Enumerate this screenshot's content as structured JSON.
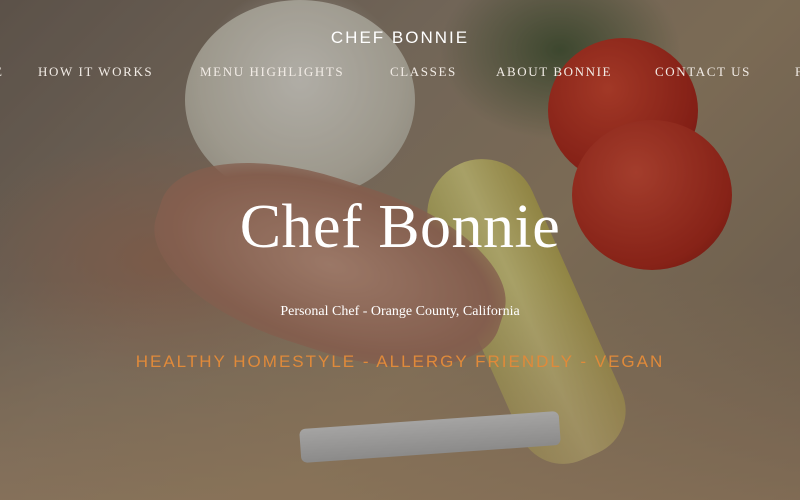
{
  "header": {
    "brand": "CHEF BONNIE"
  },
  "nav": {
    "items": [
      {
        "label": "E"
      },
      {
        "label": "HOW IT WORKS"
      },
      {
        "label": "MENU HIGHLIGHTS"
      },
      {
        "label": "CLASSES"
      },
      {
        "label": "ABOUT BONNIE"
      },
      {
        "label": "CONTACT US"
      },
      {
        "label": "F"
      }
    ]
  },
  "hero": {
    "title": "Chef Bonnie",
    "subtitle": "Personal Chef - Orange County, California",
    "tagline": "HEALTHY HOMESTYLE - ALLERGY FRIENDLY - VEGAN"
  },
  "colors": {
    "accent": "#e08a3a",
    "text": "#ffffff"
  }
}
